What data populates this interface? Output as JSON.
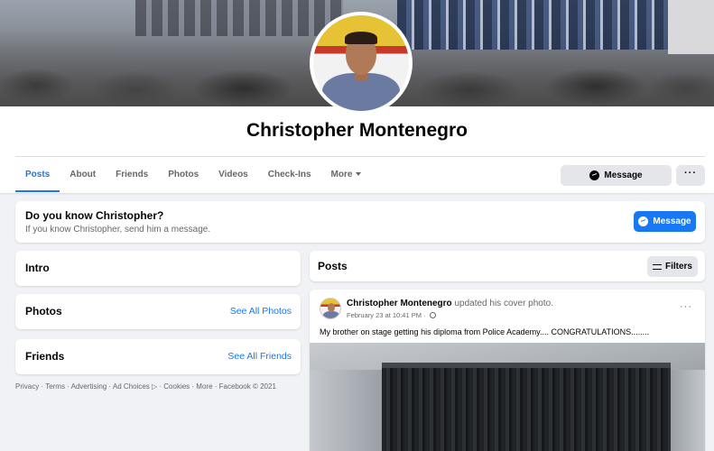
{
  "profile": {
    "name": "Christopher Montenegro"
  },
  "tabs": [
    "Posts",
    "About",
    "Friends",
    "Photos",
    "Videos",
    "Check-Ins",
    "More"
  ],
  "actions": {
    "message_label": "Message",
    "more_label": "···"
  },
  "know_card": {
    "title": "Do you know Christopher?",
    "subtitle": "If you know Christopher, send him a message.",
    "button_label": "Message"
  },
  "sidebar": {
    "intro_title": "Intro",
    "photos_title": "Photos",
    "photos_link": "See All Photos",
    "friends_title": "Friends",
    "friends_link": "See All Friends",
    "footer": "Privacy · Terms · Advertising · Ad Choices ▷ · Cookies · More · Facebook © 2021"
  },
  "posts": {
    "title": "Posts",
    "filters_label": "Filters",
    "items": [
      {
        "author": "Christopher Montenegro",
        "action": "updated his cover photo.",
        "timestamp": "February 23 at 10:41 PM · ",
        "text": "My brother on stage getting his diploma from Police Academy.... CONGRATULATIONS........",
        "more_label": "···"
      }
    ]
  },
  "colors": {
    "accent": "#1877f2",
    "background": "#f0f2f5",
    "secondary_text": "#65676b"
  }
}
